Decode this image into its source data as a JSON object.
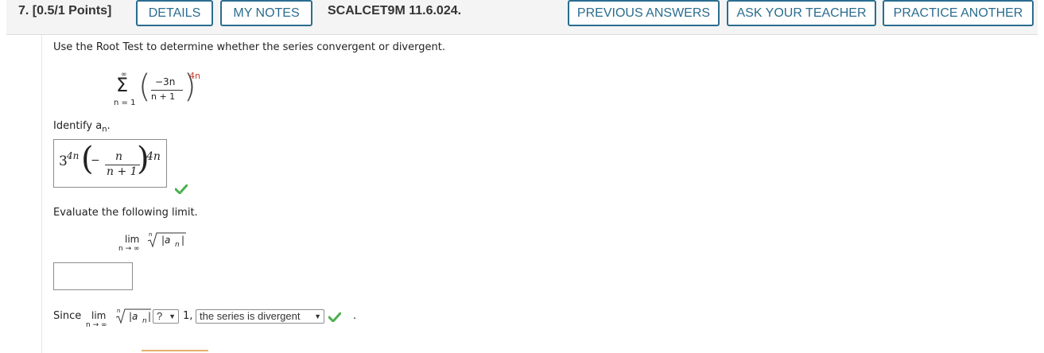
{
  "header": {
    "question_number": "7.",
    "points": "[0.5/1 Points]",
    "details_label": "DETAILS",
    "my_notes_label": "MY NOTES",
    "problem_id": "SCALCET9M 11.6.024.",
    "previous_answers_label": "PREVIOUS ANSWERS",
    "ask_teacher_label": "ASK YOUR TEACHER",
    "practice_another_label": "PRACTICE ANOTHER"
  },
  "prompt": "Use the Root Test to determine whether the series convergent or divergent.",
  "series": {
    "sigma": "Σ",
    "upper": "∞",
    "lower": "n = 1",
    "numerator": "−3n",
    "denominator": "n + 1",
    "exponent": "4n"
  },
  "identify": {
    "label": "Identify a",
    "subscript": "n",
    "period": ".",
    "answer": {
      "base": "3",
      "base_exp": "4n",
      "minus": "−",
      "numerator": "n",
      "denominator": "n + 1",
      "exponent": "4n"
    }
  },
  "evaluate": {
    "label": "Evaluate the following limit.",
    "lim": "lim",
    "lim_sub": "n → ∞",
    "root_index": "n",
    "abs_open": "|a",
    "abs_sub": "n",
    "abs_close": "|",
    "input_value": ""
  },
  "conclusion": {
    "since": "Since",
    "lim": "lim",
    "lim_sub": "n → ∞",
    "root_index": "n",
    "abs_open": "|a",
    "abs_sub": "n",
    "abs_close": "|",
    "compare_value": "?",
    "one": "1,",
    "verdict": "the series is divergent",
    "trailing": "."
  },
  "colors": {
    "accent": "#2a6d8f",
    "check": "#4caf50",
    "exponent_red": "#c0392b"
  }
}
